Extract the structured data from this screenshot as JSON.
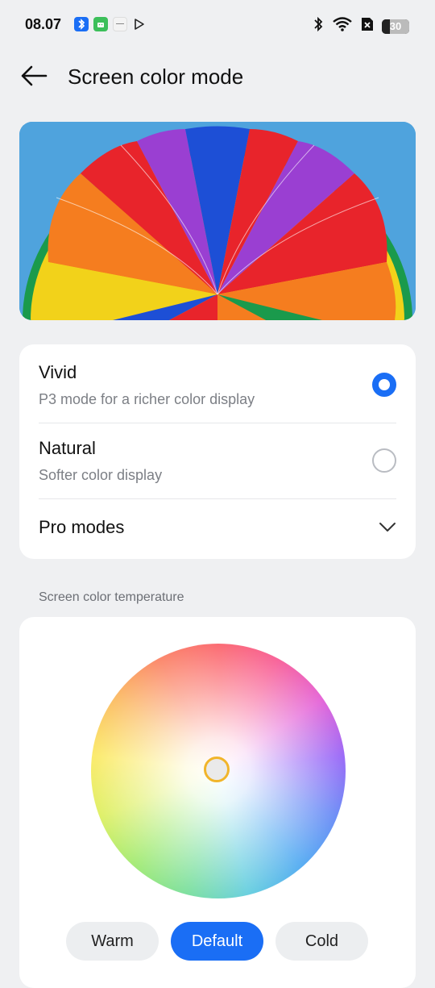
{
  "status_bar": {
    "time": "08.07",
    "battery": "30",
    "battery_level": 0.3
  },
  "header": {
    "title": "Screen color mode",
    "back_icon": "arrow-left-icon"
  },
  "modes": [
    {
      "title": "Vivid",
      "subtitle": "P3 mode for a richer color display",
      "selected": true
    },
    {
      "title": "Natural",
      "subtitle": "Softer color display",
      "selected": false
    }
  ],
  "pro_modes": {
    "label": "Pro modes",
    "icon": "chevron-down-icon"
  },
  "temperature": {
    "section_label": "Screen color temperature",
    "presets": [
      {
        "label": "Warm",
        "active": false
      },
      {
        "label": "Default",
        "active": true
      },
      {
        "label": "Cold",
        "active": false
      }
    ]
  },
  "colors": {
    "accent": "#1a6ef5",
    "handle": "#f1b52a",
    "background": "#eff0f2"
  }
}
